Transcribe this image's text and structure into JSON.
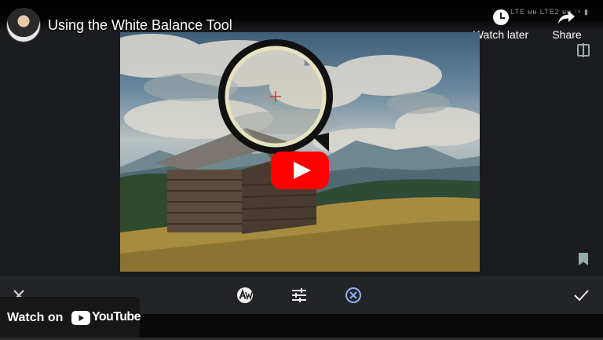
{
  "video": {
    "title": "Using the White Balance Tool",
    "actions": {
      "watch_later": "Watch later",
      "share": "Share"
    }
  },
  "status_bar": {
    "text": "LTE ᵾᵾ LTE2 ᵾᵾ ⁷⁸ ▮"
  },
  "editor": {
    "toolbar": {
      "close_icon": "close-icon",
      "auto_white_balance_icon": "auto-white-balance-icon",
      "tune_icon": "tune-sliders-icon",
      "white_balance_picker_icon": "white-balance-picker-icon",
      "done_icon": "check-icon"
    }
  },
  "overlay": {
    "watch_on": "Watch on",
    "youtube": "YouTube",
    "colors": {
      "youtube_red": "#ff0000",
      "accent_blue": "#8ab4f8"
    }
  }
}
